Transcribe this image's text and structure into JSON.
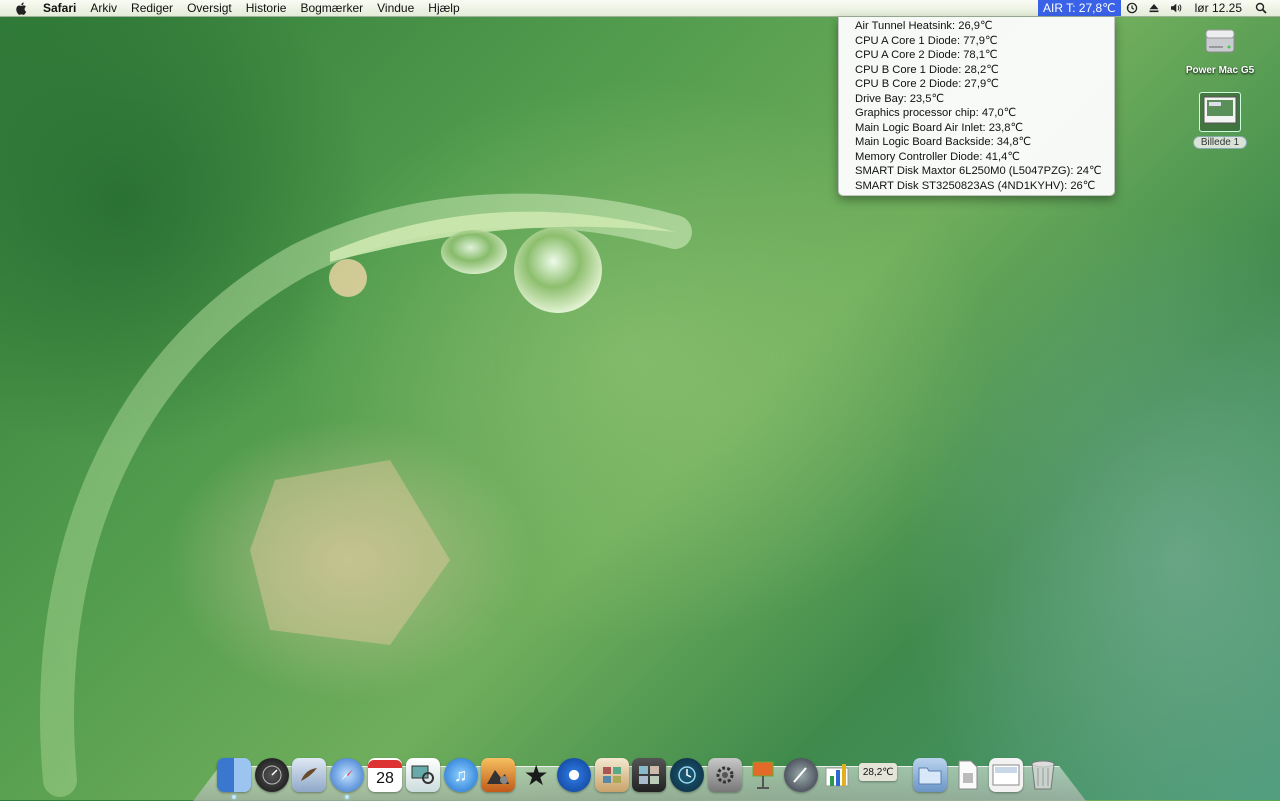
{
  "menubar": {
    "app_name": "Safari",
    "items": [
      "Arkiv",
      "Rediger",
      "Oversigt",
      "Historie",
      "Bogmærker",
      "Vindue",
      "Hjælp"
    ],
    "temp_status": "AIR T: 27,8℃",
    "clock": "lør 12.25",
    "icons": [
      "time-machine-icon",
      "eject-icon",
      "volume-icon",
      "spotlight-icon"
    ]
  },
  "temp_menu": {
    "rows": [
      "Air Tunnel Heatsink: 26,9℃",
      "CPU A Core 1 Diode: 77,9℃",
      "CPU A Core 2 Diode: 78,1℃",
      "CPU B Core 1 Diode: 28,2℃",
      "CPU B Core 2 Diode: 27,9℃",
      "Drive Bay: 23,5℃",
      "Graphics processor chip: 47,0℃",
      "Main Logic Board Air Inlet: 23,8℃",
      "Main Logic Board Backside: 34,8℃",
      "Memory Controller Diode: 41,4℃",
      "SMART Disk Maxtor 6L250M0 (L5047PZG): 24℃",
      "SMART Disk ST3250823AS (4ND1KYHV): 26℃"
    ]
  },
  "desktop": {
    "icons": [
      {
        "label": "Power Mac G5",
        "icon": "hard-drive-icon"
      },
      {
        "label": "Billede 1",
        "icon": "screenshot-file-icon"
      }
    ]
  },
  "dock": {
    "calendar_date": "28",
    "temp_widget": "28,2℃",
    "apps": [
      "finder",
      "dashboard",
      "mail",
      "safari",
      "ical",
      "preview",
      "itunes",
      "iphoto",
      "imovie",
      "dvd-player",
      "photo-booth",
      "spaces",
      "time-machine",
      "system-preferences",
      "keynote",
      "script-editor",
      "numbers",
      "temperature-monitor"
    ],
    "colors": {
      "finder": "#5b8fd6",
      "dashboard": "#333333",
      "mail": "#6c8fb8",
      "safari": "#3b7fd4",
      "itunes": "#2a7fd8",
      "iphoto": "#d98a2a"
    }
  }
}
